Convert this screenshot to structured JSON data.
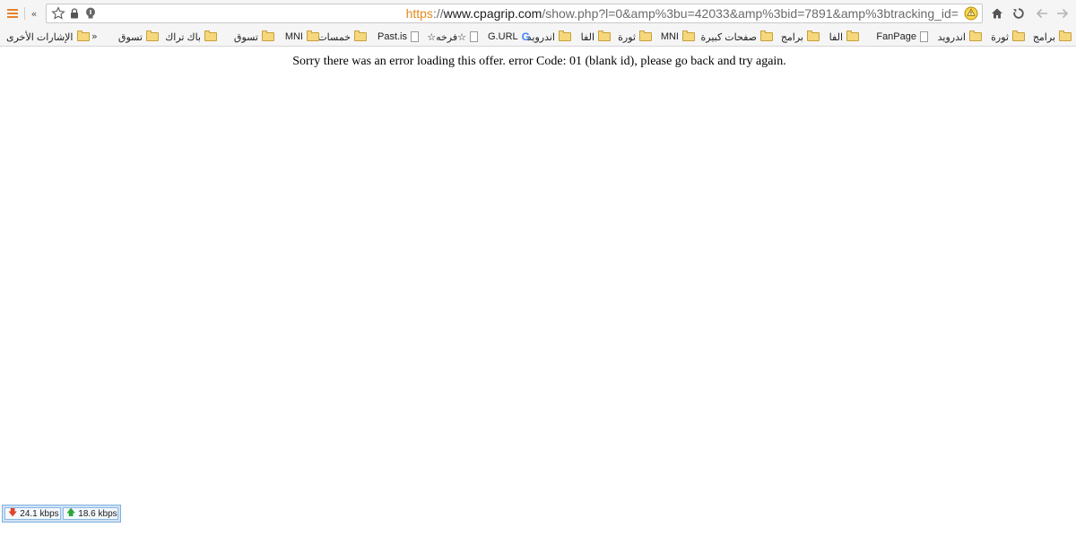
{
  "toolbar": {
    "overflow_label": "«",
    "url": {
      "scheme": "https",
      "sep": "://",
      "host": "www.cpagrip.com",
      "path": "/show.php?l=0&amp%3bu=42033&amp%3bid=7891&amp%3btracking_id="
    }
  },
  "bookmarks": {
    "chevron": "»",
    "items": [
      {
        "label": "برامج",
        "icon": "folder-icon"
      },
      {
        "label": "ثورة",
        "icon": "folder-icon"
      },
      {
        "label": "اندرويد",
        "icon": "folder-icon"
      },
      {
        "label": "FanPage",
        "icon": "page-icon"
      },
      {
        "label": "الفا",
        "icon": "folder-icon"
      },
      {
        "label": "برامج",
        "icon": "folder-icon"
      },
      {
        "label": "صفحات كبيرة",
        "icon": "folder-icon"
      },
      {
        "label": "MNI",
        "icon": "folder-icon"
      },
      {
        "label": "ثورة",
        "icon": "folder-icon"
      },
      {
        "label": "الفا",
        "icon": "folder-icon"
      },
      {
        "label": "اندرويد",
        "icon": "folder-icon"
      },
      {
        "label": "G.URL",
        "icon": "google-icon"
      },
      {
        "label": "☆فرخه☆",
        "icon": "page-icon"
      },
      {
        "label": "Past.is",
        "icon": "page-icon"
      },
      {
        "label": "خمسات",
        "icon": "folder-icon"
      },
      {
        "label": "MNI",
        "icon": "folder-icon"
      },
      {
        "label": "تسوق",
        "icon": "folder-icon"
      },
      {
        "label": "باك تراك",
        "icon": "folder-icon"
      },
      {
        "label": "تسوق",
        "icon": "folder-icon"
      }
    ],
    "other": {
      "label": "الإشارات الأخرى",
      "icon": "folder-icon"
    }
  },
  "content": {
    "error_message": "Sorry there was an error loading this offer. error Code: 01 (blank id), please go back and try again."
  },
  "speed_meter": {
    "download": "24.1 kbps",
    "upload": "18.6 kbps"
  },
  "colors": {
    "scheme": "#e38a1c",
    "menu_accent": "#e8812d",
    "folder": "#f6d77b",
    "download_arrow": "#e0442b",
    "upload_arrow": "#2ca43a"
  }
}
